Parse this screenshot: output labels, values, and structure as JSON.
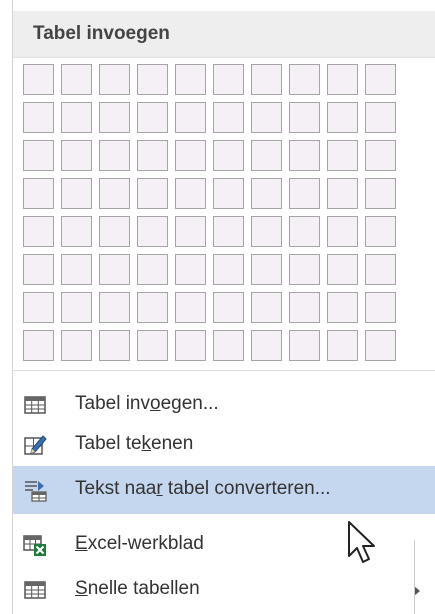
{
  "header": {
    "title": "Tabel invoegen"
  },
  "grid": {
    "rows": 8,
    "cols": 10
  },
  "menu_items": [
    {
      "id": "insert-table",
      "pre": "Tabel inv",
      "u": "o",
      "post": "egen...",
      "icon": "table-grid-icon"
    },
    {
      "id": "draw-table",
      "pre": "Tabel te",
      "u": "k",
      "post": "enen",
      "icon": "draw-table-pencil-icon"
    },
    {
      "id": "convert-text",
      "pre": "Tekst naa",
      "u": "r",
      "post": " tabel converteren...",
      "icon": "text-to-table-icon"
    },
    {
      "id": "excel-sheet",
      "pre": "",
      "u": "E",
      "post": "xcel-werkblad",
      "icon": "excel-sheet-icon"
    },
    {
      "id": "quick-tables",
      "pre": "",
      "u": "S",
      "post": "nelle tabellen",
      "icon": "quick-tables-icon"
    }
  ],
  "colors": {
    "hover": "#c5d7ef",
    "cell_fill": "#f5f0f5",
    "cell_border": "#a5a5a5",
    "header_bg": "#eeeeee",
    "excel_green": "#1f7a3c"
  }
}
